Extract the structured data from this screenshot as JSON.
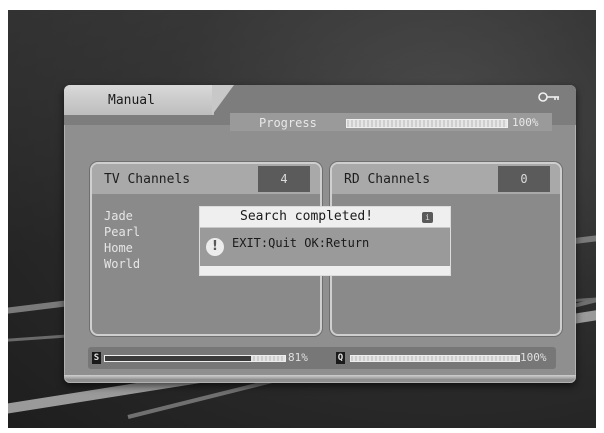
{
  "header": {
    "mode_label": "Manual",
    "progress_label": "Progress",
    "progress_fraction": 1.0,
    "progress_value": "100%",
    "key_icon": "key-icon"
  },
  "tv_channels": {
    "label": "TV Channels",
    "count": "4",
    "items": [
      "Jade",
      "Pearl",
      "Home",
      "World"
    ]
  },
  "rd_channels": {
    "label": "RD Channels",
    "count": "0"
  },
  "dialog": {
    "title": "Search completed!",
    "message": "EXIT:Quit OK:Return",
    "icon": "warning-icon"
  },
  "signal": {
    "strength_letter": "S",
    "strength_fraction": 0.81,
    "strength_value": "81%",
    "quality_letter": "Q",
    "quality_fraction": 1.0,
    "quality_value": "100%"
  },
  "colors": {
    "panel": "#8f8f8f",
    "dialog_title_bar": "#efefef",
    "count_badge": "#5b5b5b"
  }
}
